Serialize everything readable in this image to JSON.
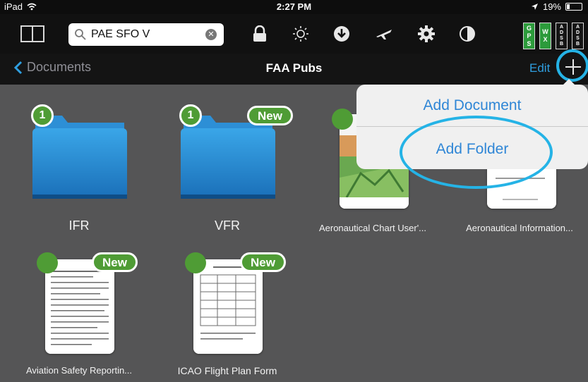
{
  "status": {
    "device": "iPad",
    "time": "2:27 PM",
    "battery": "19%"
  },
  "toolbar": {
    "search_value": "PAE SFO V",
    "icons": [
      "sidebar-icon",
      "search-icon",
      "clear-icon",
      "lock-icon",
      "brightness-icon",
      "download-icon",
      "airplane-icon",
      "gear-icon",
      "contrast-icon"
    ],
    "gps_letters": [
      "G",
      "P",
      "S"
    ],
    "wx_letters": [
      "W",
      "X"
    ],
    "adsb_letters": [
      "A",
      "D",
      "S",
      "B"
    ]
  },
  "nav": {
    "back_label": "Documents",
    "title": "FAA Pubs",
    "edit_label": "Edit"
  },
  "colors": {
    "accent": "#2f86d6",
    "badge_green": "#4f9c35",
    "highlight": "#25b3e6"
  },
  "items": [
    {
      "label": "IFR",
      "count": "1"
    },
    {
      "label": "VFR",
      "count": "1",
      "badge": "New"
    },
    {
      "label": "Aeronautical Chart User'..."
    },
    {
      "label": "Aeronautical Information..."
    },
    {
      "label": "Aviation Safety Reportin...",
      "badge": "New"
    },
    {
      "label": "ICAO Flight Plan Form",
      "badge": "New"
    }
  ],
  "popover": {
    "add_document": "Add Document",
    "add_folder": "Add Folder"
  }
}
